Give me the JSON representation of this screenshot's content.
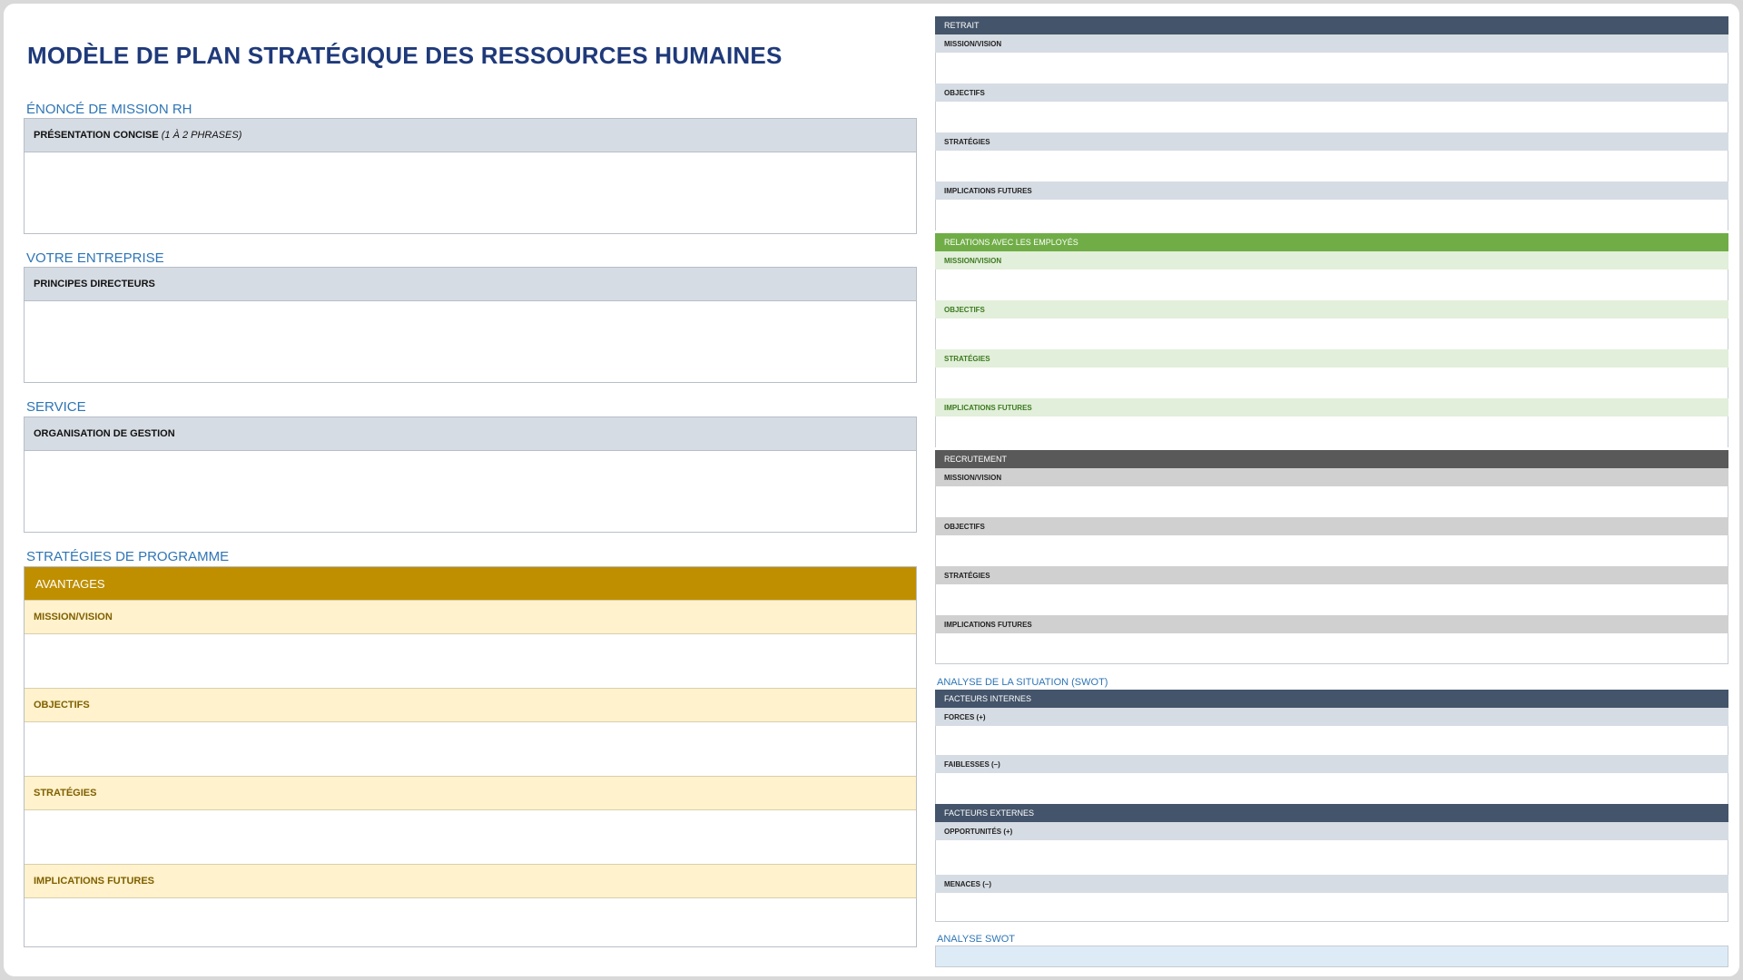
{
  "title": "MODÈLE DE PLAN STRATÉGIQUE DES RESSOURCES HUMAINES",
  "left": {
    "mission": {
      "label": "ÉNONCÉ DE MISSION RH",
      "header": "PRÉSENTATION CONCISE",
      "header_note": "(1 À 2 PHRASES)"
    },
    "entreprise": {
      "label": "VOTRE ENTREPRISE",
      "header": "PRINCIPES DIRECTEURS"
    },
    "service": {
      "label": "SERVICE",
      "header": "ORGANISATION DE GESTION"
    },
    "programme": {
      "label": "STRATÉGIES DE PROGRAMME",
      "header": "AVANTAGES",
      "rows": [
        "MISSION/VISION",
        "OBJECTIFS",
        "STRATÉGIES",
        "IMPLICATIONS FUTURES"
      ]
    }
  },
  "right": {
    "retrait": {
      "header": "RETRAIT",
      "rows": [
        "MISSION/VISION",
        "OBJECTIFS",
        "STRATÉGIES",
        "IMPLICATIONS FUTURES"
      ]
    },
    "relations": {
      "header": "RELATIONS AVEC LES EMPLOYÉS",
      "rows": [
        "MISSION/VISION",
        "OBJECTIFS",
        "STRATÉGIES",
        "IMPLICATIONS FUTURES"
      ]
    },
    "recrutement": {
      "header": "RECRUTEMENT",
      "rows": [
        "MISSION/VISION",
        "OBJECTIFS",
        "STRATÉGIES",
        "IMPLICATIONS FUTURES"
      ]
    },
    "swot_situation": {
      "label": "ANALYSE DE LA SITUATION (SWOT)",
      "internes": {
        "header": "FACTEURS INTERNES",
        "rows": [
          "FORCES (+)",
          "FAIBLESSES (–)"
        ]
      },
      "externes": {
        "header": "FACTEURS EXTERNES",
        "rows": [
          "OPPORTUNITÉS (+)",
          "MENACES (–)"
        ]
      }
    },
    "swot": {
      "label": "ANALYSE SWOT"
    }
  },
  "colors": {
    "title": "#1f3a7a",
    "section_label": "#2e75b6",
    "gray_header": "#d6dce4",
    "gold": "#bf8f00",
    "gold_light": "#fff2cc",
    "navy": "#44546a",
    "green": "#70ad47",
    "green_light": "#e2efda",
    "charcoal": "#595959",
    "gray_light": "#d0d0d0",
    "swot_blue": "#ddebf7"
  }
}
